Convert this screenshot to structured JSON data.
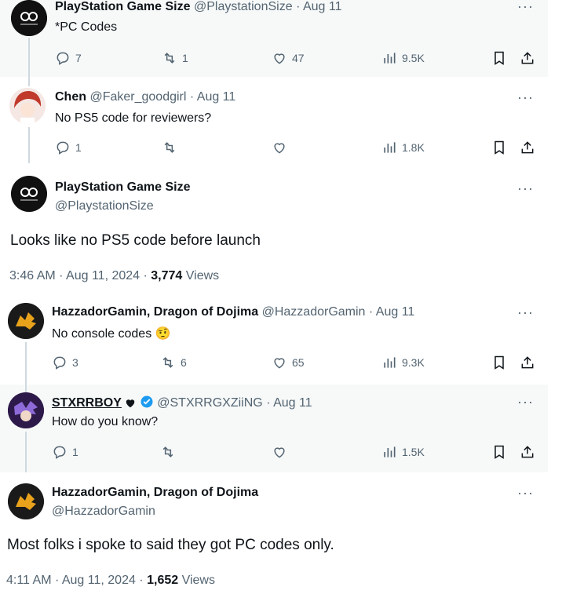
{
  "tweets": [
    {
      "name": "PlayStation Game Size",
      "handle": "@PlaystationSize",
      "date": "· Aug 11",
      "text": "*PC Codes",
      "replies": "7",
      "retweets": "1",
      "likes": "47",
      "views": "9.5K"
    },
    {
      "name": "Chen",
      "handle": "@Faker_goodgirl",
      "date": "· Aug 11",
      "text": "No PS5 code for reviewers?",
      "replies": "1",
      "retweets": "",
      "likes": "",
      "views": "1.8K"
    },
    {
      "name": "PlayStation Game Size",
      "handle": "@PlaystationSize",
      "text": "Looks like no PS5 code before launch",
      "time": "3:46 AM · Aug 11, 2024 ·",
      "views_count": "3,774",
      "views_label": "Views"
    },
    {
      "name": "HazzadorGamin, Dragon of Dojima",
      "handle": "@HazzadorGamin",
      "date": "· Aug 11",
      "text": "No console codes",
      "emoji": "🤨",
      "replies": "3",
      "retweets": "6",
      "likes": "65",
      "views": "9.3K"
    },
    {
      "name": "STXRRBOY",
      "handle": "@STXRRGXZiiNG",
      "date": "· Aug 11",
      "text": "How do you know?",
      "replies": "1",
      "retweets": "",
      "likes": "",
      "views": "1.5K"
    },
    {
      "name": "HazzadorGamin, Dragon of Dojima",
      "handle": "@HazzadorGamin",
      "text": "Most folks i spoke to said they got PC codes only.",
      "time": "4:11 AM · Aug 11, 2024 ·",
      "views_count": "1,652",
      "views_label": "Views"
    }
  ],
  "more_label": "···",
  "colors": {
    "muted": "#536471",
    "text": "#0f1419",
    "verified": "#1d9bf0",
    "thread_line": "#cfd9de"
  }
}
